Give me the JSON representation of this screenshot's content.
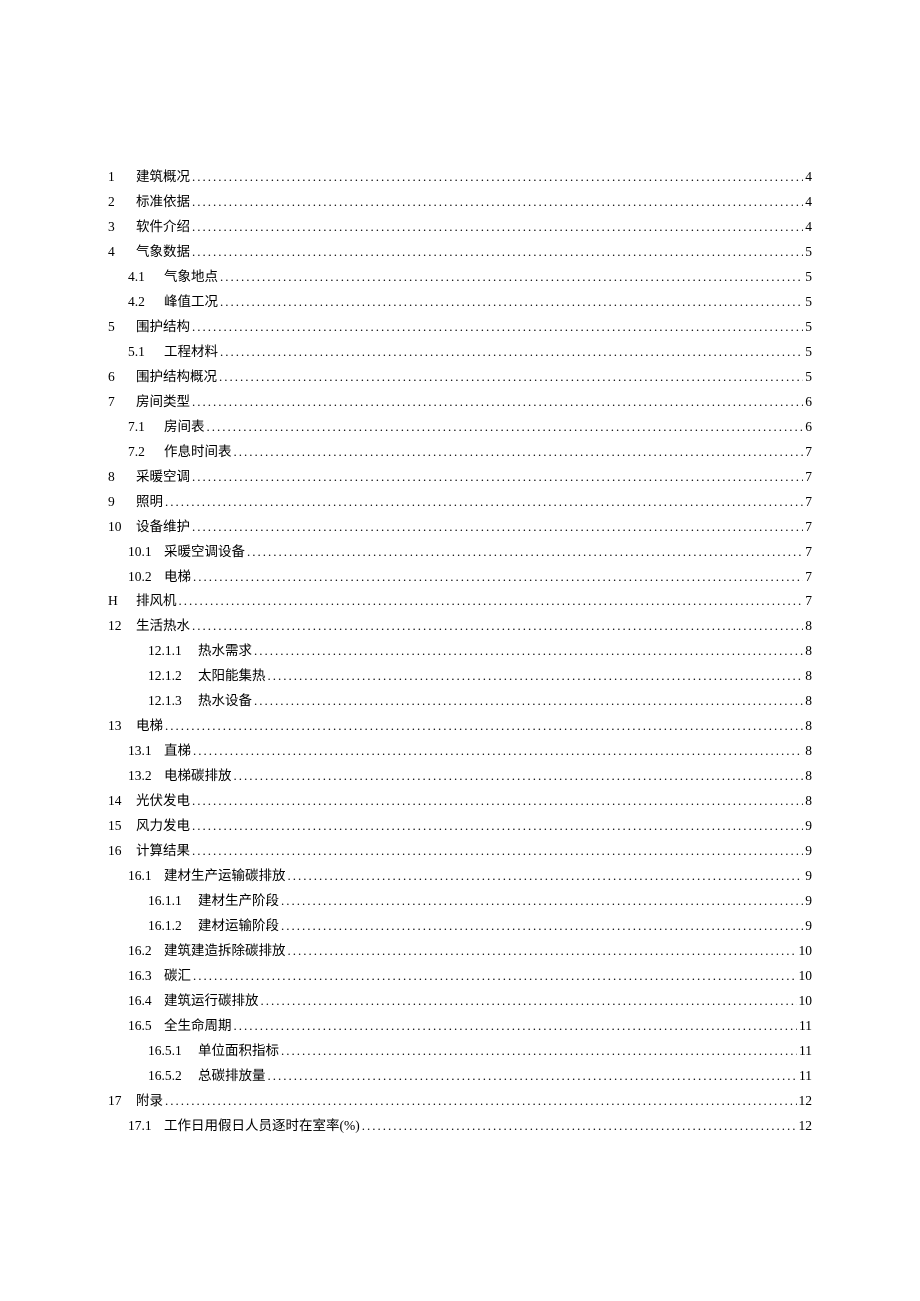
{
  "toc": [
    {
      "level": 1,
      "num": "1",
      "title": "建筑概况",
      "page": "4"
    },
    {
      "level": 1,
      "num": "2",
      "title": "标准依据",
      "page": "4"
    },
    {
      "level": 1,
      "num": "3",
      "title": "软件介绍",
      "page": "4"
    },
    {
      "level": 1,
      "num": "4",
      "title": "气象数据",
      "page": "5"
    },
    {
      "level": 2,
      "num": "4.1",
      "title": "气象地点",
      "page": "5"
    },
    {
      "level": 2,
      "num": "4.2",
      "title": "峰值工况",
      "page": "5"
    },
    {
      "level": 1,
      "num": "5",
      "title": "围护结构",
      "page": "5"
    },
    {
      "level": 2,
      "num": "5.1",
      "title": "工程材料",
      "page": "5"
    },
    {
      "level": 1,
      "num": "6",
      "title": "围护结构概况",
      "page": "5"
    },
    {
      "level": 1,
      "num": "7",
      "title": "房间类型",
      "page": "6"
    },
    {
      "level": 2,
      "num": "7.1",
      "title": "房间表",
      "page": "6"
    },
    {
      "level": 2,
      "num": "7.2",
      "title": "作息时间表",
      "page": "7"
    },
    {
      "level": 1,
      "num": "8",
      "title": "采暖空调",
      "page": "7"
    },
    {
      "level": 1,
      "num": "9",
      "title": "照明",
      "page": "7"
    },
    {
      "level": 1,
      "num": "10",
      "title": "设备维护",
      "page": "7"
    },
    {
      "level": 2,
      "num": "10.1",
      "title": "采暖空调设备",
      "page": "7"
    },
    {
      "level": 2,
      "num": "10.2",
      "title": "电梯",
      "page": "7"
    },
    {
      "level": 1,
      "num": "H",
      "title": "排风机",
      "page": "7"
    },
    {
      "level": 1,
      "num": "12",
      "title": "生活热水",
      "page": "8"
    },
    {
      "level": 3,
      "num": "12.1.1",
      "title": "热水需求",
      "page": "8"
    },
    {
      "level": 3,
      "num": "12.1.2",
      "title": "太阳能集热",
      "page": "8"
    },
    {
      "level": 3,
      "num": "12.1.3",
      "title": "热水设备",
      "page": "8"
    },
    {
      "level": 1,
      "num": "13",
      "title": "电梯",
      "page": "8"
    },
    {
      "level": 2,
      "num": "13.1",
      "title": "直梯",
      "page": "8"
    },
    {
      "level": 2,
      "num": "13.2",
      "title": "电梯碳排放",
      "page": "8"
    },
    {
      "level": 1,
      "num": "14",
      "title": "光伏发电",
      "page": "8"
    },
    {
      "level": 1,
      "num": "15",
      "title": "风力发电",
      "page": "9"
    },
    {
      "level": 1,
      "num": "16",
      "title": "计算结果",
      "page": "9"
    },
    {
      "level": 2,
      "num": "16.1",
      "title": "建材生产运输碳排放",
      "page": "9"
    },
    {
      "level": 3,
      "num": "16.1.1",
      "title": "建材生产阶段",
      "page": "9"
    },
    {
      "level": 3,
      "num": "16.1.2",
      "title": "建材运输阶段",
      "page": "9"
    },
    {
      "level": 2,
      "num": "16.2",
      "title": "建筑建造拆除碳排放",
      "page": "10"
    },
    {
      "level": 2,
      "num": "16.3",
      "title": "碳汇",
      "page": "10"
    },
    {
      "level": 2,
      "num": "16.4",
      "title": "建筑运行碳排放",
      "page": "10"
    },
    {
      "level": 2,
      "num": "16.5",
      "title": "全生命周期",
      "page": "11"
    },
    {
      "level": 3,
      "num": "16.5.1",
      "title": "单位面积指标",
      "page": "11"
    },
    {
      "level": 3,
      "num": "16.5.2",
      "title": "总碳排放量",
      "page": "11"
    },
    {
      "level": 1,
      "num": "17",
      "title": "附录",
      "page": "12"
    },
    {
      "level": 2,
      "num": "17.1",
      "title": "工作日用假日人员逐时在室率(%)",
      "page": "12"
    }
  ]
}
